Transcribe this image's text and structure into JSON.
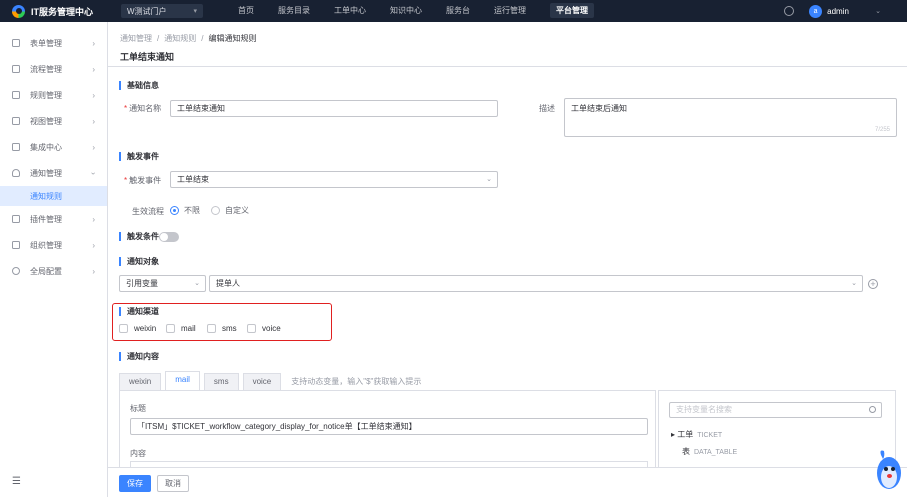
{
  "app": {
    "title": "IT服务管理中心",
    "portal": "W测试门户"
  },
  "nav": [
    "首页",
    "服务目录",
    "工单中心",
    "知识中心",
    "服务台",
    "运行管理",
    "平台管理"
  ],
  "nav_active": "平台管理",
  "user": {
    "avatar_letter": "a",
    "name": "admin"
  },
  "sidebar": {
    "items": [
      {
        "label": "表单管理",
        "icon": "form-icon"
      },
      {
        "label": "流程管理",
        "icon": "flow-icon"
      },
      {
        "label": "规则管理",
        "icon": "rule-icon"
      },
      {
        "label": "视图管理",
        "icon": "view-icon"
      },
      {
        "label": "集成中心",
        "icon": "integration-icon"
      },
      {
        "label": "通知管理",
        "icon": "bell-icon"
      },
      {
        "label": "插件管理",
        "icon": "plugin-icon"
      },
      {
        "label": "组织管理",
        "icon": "org-icon"
      },
      {
        "label": "全局配置",
        "icon": "settings-icon"
      }
    ],
    "active_sub": "通知规则"
  },
  "breadcrumb": [
    "通知管理",
    "通知规则",
    "编辑通知规则"
  ],
  "page_title": "工单结束通知",
  "basic": {
    "title": "基础信息",
    "name_label": "通知名称",
    "name_value": "工单结束通知",
    "desc_label": "描述",
    "desc_value": "工单结束后通知",
    "desc_counter": "7/255"
  },
  "trigger": {
    "title": "触发事件",
    "event_label": "触发事件",
    "event_value": "工单结束",
    "flow_label": "生效流程",
    "flow_options": [
      "不限",
      "自定义"
    ]
  },
  "condition": {
    "title": "触发条件"
  },
  "target": {
    "title": "通知对象",
    "type_value": "引用变量",
    "value": "提单人"
  },
  "channel": {
    "title": "通知渠道",
    "options": [
      "weixin",
      "mail",
      "sms",
      "voice"
    ]
  },
  "content": {
    "title": "通知内容",
    "tabs": [
      "weixin",
      "mail",
      "sms",
      "voice"
    ],
    "active_tab": "mail",
    "hint": "支持动态变量，输入\"$\"获取输入提示",
    "subject_label": "标题",
    "subject_value": "「ITSM」$TICKET_workflow_category_display_for_notice单【工单结束通知】",
    "body_label": "内容"
  },
  "variables": {
    "search_placeholder": "支持变量名搜索",
    "tree": [
      {
        "name": "工单",
        "code": "TICKET"
      },
      {
        "name": "表",
        "code": "DATA_TABLE"
      }
    ]
  },
  "footer": {
    "save": "保存",
    "cancel": "取消"
  }
}
